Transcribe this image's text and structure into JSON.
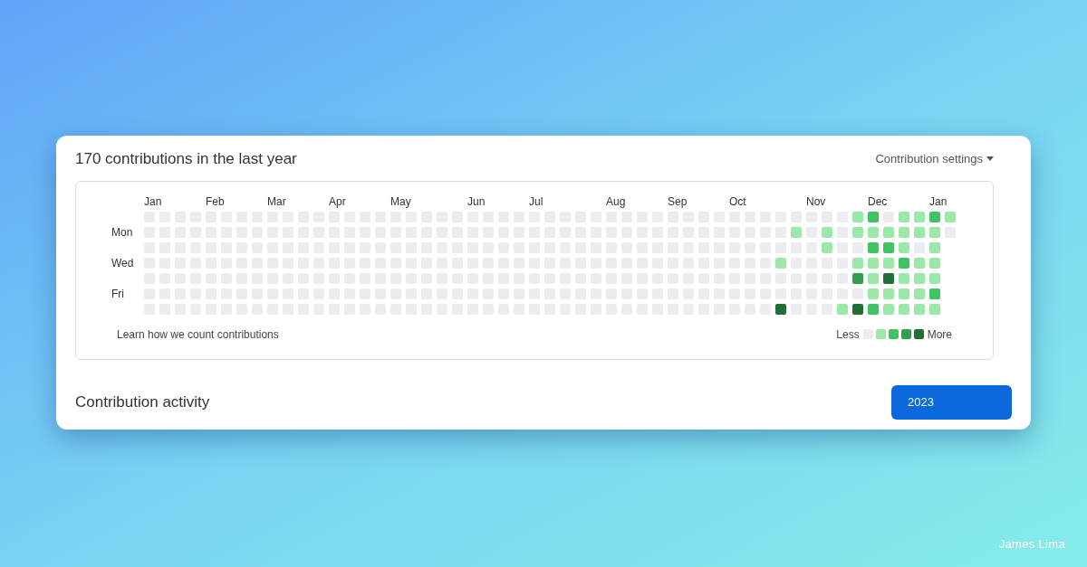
{
  "title": "170 contributions in the last year",
  "settings_menu": {
    "label": "Contribution settings"
  },
  "day_labels": [
    "Mon",
    "Wed",
    "Fri"
  ],
  "weeks": [
    {
      "month": "Jan",
      "days": [
        {
          "color": "#ebedf0"
        },
        {
          "color": "#ebedf0"
        },
        {
          "color": "#ebedf0"
        },
        {
          "color": "#ebedf0"
        },
        {
          "color": "#ebedf0"
        },
        {
          "color": "#ebedf0"
        },
        {
          "color": "#ebedf0"
        }
      ]
    },
    {
      "days": [
        {
          "color": "#ebedf0"
        },
        {
          "color": "#ebedf0"
        },
        {
          "color": "#ebedf0"
        },
        {
          "color": "#ebedf0"
        },
        {
          "color": "#ebedf0"
        },
        {
          "color": "#ebedf0"
        },
        {
          "color": "#ebedf0"
        }
      ]
    },
    {
      "days": [
        {
          "color": "#ebedf0"
        },
        {
          "color": "#ebedf0"
        },
        {
          "color": "#ebedf0"
        },
        {
          "color": "#ebedf0"
        },
        {
          "color": "#ebedf0"
        },
        {
          "color": "#ebedf0"
        },
        {
          "color": "#ebedf0"
        }
      ]
    },
    {
      "days": [
        {
          "color": "#ebedf0"
        },
        {
          "color": "#ebedf0"
        },
        {
          "color": "#ebedf0"
        },
        {
          "color": "#ebedf0"
        },
        {
          "color": "#ebedf0"
        },
        {
          "color": "#ebedf0"
        },
        {
          "color": "#ebedf0"
        }
      ]
    },
    {
      "month": "Feb",
      "days": [
        {
          "color": "#ebedf0"
        },
        {
          "color": "#ebedf0"
        },
        {
          "color": "#ebedf0"
        },
        {
          "color": "#ebedf0"
        },
        {
          "color": "#ebedf0"
        },
        {
          "color": "#ebedf0"
        },
        {
          "color": "#ebedf0"
        }
      ]
    },
    {
      "days": [
        {
          "color": "#ebedf0"
        },
        {
          "color": "#ebedf0"
        },
        {
          "color": "#ebedf0"
        },
        {
          "color": "#ebedf0"
        },
        {
          "color": "#ebedf0"
        },
        {
          "color": "#ebedf0"
        },
        {
          "color": "#ebedf0"
        }
      ]
    },
    {
      "days": [
        {
          "color": "#ebedf0"
        },
        {
          "color": "#ebedf0"
        },
        {
          "color": "#ebedf0"
        },
        {
          "color": "#ebedf0"
        },
        {
          "color": "#ebedf0"
        },
        {
          "color": "#ebedf0"
        },
        {
          "color": "#ebedf0"
        }
      ]
    },
    {
      "days": [
        {
          "color": "#ebedf0"
        },
        {
          "color": "#ebedf0"
        },
        {
          "color": "#ebedf0"
        },
        {
          "color": "#ebedf0"
        },
        {
          "color": "#ebedf0"
        },
        {
          "color": "#ebedf0"
        },
        {
          "color": "#ebedf0"
        }
      ]
    },
    {
      "month": "Mar",
      "days": [
        {
          "color": "#ebedf0"
        },
        {
          "color": "#ebedf0"
        },
        {
          "color": "#ebedf0"
        },
        {
          "color": "#ebedf0"
        },
        {
          "color": "#ebedf0"
        },
        {
          "color": "#ebedf0"
        },
        {
          "color": "#ebedf0"
        }
      ]
    },
    {
      "days": [
        {
          "color": "#ebedf0"
        },
        {
          "color": "#ebedf0"
        },
        {
          "color": "#ebedf0"
        },
        {
          "color": "#ebedf0"
        },
        {
          "color": "#ebedf0"
        },
        {
          "color": "#ebedf0"
        },
        {
          "color": "#ebedf0"
        }
      ]
    },
    {
      "days": [
        {
          "color": "#ebedf0"
        },
        {
          "color": "#ebedf0"
        },
        {
          "color": "#ebedf0"
        },
        {
          "color": "#ebedf0"
        },
        {
          "color": "#ebedf0"
        },
        {
          "color": "#ebedf0"
        },
        {
          "color": "#ebedf0"
        }
      ]
    },
    {
      "days": [
        {
          "color": "#ebedf0"
        },
        {
          "color": "#ebedf0"
        },
        {
          "color": "#ebedf0"
        },
        {
          "color": "#ebedf0"
        },
        {
          "color": "#ebedf0"
        },
        {
          "color": "#ebedf0"
        },
        {
          "color": "#ebedf0"
        }
      ]
    },
    {
      "month": "Apr",
      "days": [
        {
          "color": "#ebedf0"
        },
        {
          "color": "#ebedf0"
        },
        {
          "color": "#ebedf0"
        },
        {
          "color": "#ebedf0"
        },
        {
          "color": "#ebedf0"
        },
        {
          "color": "#ebedf0"
        },
        {
          "color": "#ebedf0"
        }
      ]
    },
    {
      "days": [
        {
          "color": "#ebedf0"
        },
        {
          "color": "#ebedf0"
        },
        {
          "color": "#ebedf0"
        },
        {
          "color": "#ebedf0"
        },
        {
          "color": "#ebedf0"
        },
        {
          "color": "#ebedf0"
        },
        {
          "color": "#ebedf0"
        }
      ]
    },
    {
      "days": [
        {
          "color": "#ebedf0"
        },
        {
          "color": "#ebedf0"
        },
        {
          "color": "#ebedf0"
        },
        {
          "color": "#ebedf0"
        },
        {
          "color": "#ebedf0"
        },
        {
          "color": "#ebedf0"
        },
        {
          "color": "#ebedf0"
        }
      ]
    },
    {
      "days": [
        {
          "color": "#ebedf0"
        },
        {
          "color": "#ebedf0"
        },
        {
          "color": "#ebedf0"
        },
        {
          "color": "#ebedf0"
        },
        {
          "color": "#ebedf0"
        },
        {
          "color": "#ebedf0"
        },
        {
          "color": "#ebedf0"
        }
      ]
    },
    {
      "month": "May",
      "days": [
        {
          "color": "#ebedf0"
        },
        {
          "color": "#ebedf0"
        },
        {
          "color": "#ebedf0"
        },
        {
          "color": "#ebedf0"
        },
        {
          "color": "#ebedf0"
        },
        {
          "color": "#ebedf0"
        },
        {
          "color": "#ebedf0"
        }
      ]
    },
    {
      "days": [
        {
          "color": "#ebedf0"
        },
        {
          "color": "#ebedf0"
        },
        {
          "color": "#ebedf0"
        },
        {
          "color": "#ebedf0"
        },
        {
          "color": "#ebedf0"
        },
        {
          "color": "#ebedf0"
        },
        {
          "color": "#ebedf0"
        }
      ]
    },
    {
      "days": [
        {
          "color": "#ebedf0"
        },
        {
          "color": "#ebedf0"
        },
        {
          "color": "#ebedf0"
        },
        {
          "color": "#ebedf0"
        },
        {
          "color": "#ebedf0"
        },
        {
          "color": "#ebedf0"
        },
        {
          "color": "#ebedf0"
        }
      ]
    },
    {
      "days": [
        {
          "color": "#ebedf0"
        },
        {
          "color": "#ebedf0"
        },
        {
          "color": "#ebedf0"
        },
        {
          "color": "#ebedf0"
        },
        {
          "color": "#ebedf0"
        },
        {
          "color": "#ebedf0"
        },
        {
          "color": "#ebedf0"
        }
      ]
    },
    {
      "days": [
        {
          "color": "#ebedf0"
        },
        {
          "color": "#ebedf0"
        },
        {
          "color": "#ebedf0"
        },
        {
          "color": "#ebedf0"
        },
        {
          "color": "#ebedf0"
        },
        {
          "color": "#ebedf0"
        },
        {
          "color": "#ebedf0"
        }
      ]
    },
    {
      "month": "Jun",
      "days": [
        {
          "color": "#ebedf0"
        },
        {
          "color": "#ebedf0"
        },
        {
          "color": "#ebedf0"
        },
        {
          "color": "#ebedf0"
        },
        {
          "color": "#ebedf0"
        },
        {
          "color": "#ebedf0"
        },
        {
          "color": "#ebedf0"
        }
      ]
    },
    {
      "days": [
        {
          "color": "#ebedf0"
        },
        {
          "color": "#ebedf0"
        },
        {
          "color": "#ebedf0"
        },
        {
          "color": "#ebedf0"
        },
        {
          "color": "#ebedf0"
        },
        {
          "color": "#ebedf0"
        },
        {
          "color": "#ebedf0"
        }
      ]
    },
    {
      "days": [
        {
          "color": "#ebedf0"
        },
        {
          "color": "#ebedf0"
        },
        {
          "color": "#ebedf0"
        },
        {
          "color": "#ebedf0"
        },
        {
          "color": "#ebedf0"
        },
        {
          "color": "#ebedf0"
        },
        {
          "color": "#ebedf0"
        }
      ]
    },
    {
      "days": [
        {
          "color": "#ebedf0"
        },
        {
          "color": "#ebedf0"
        },
        {
          "color": "#ebedf0"
        },
        {
          "color": "#ebedf0"
        },
        {
          "color": "#ebedf0"
        },
        {
          "color": "#ebedf0"
        },
        {
          "color": "#ebedf0"
        }
      ]
    },
    {
      "month": "Jul",
      "days": [
        {
          "color": "#ebedf0"
        },
        {
          "color": "#ebedf0"
        },
        {
          "color": "#ebedf0"
        },
        {
          "color": "#ebedf0"
        },
        {
          "color": "#ebedf0"
        },
        {
          "color": "#ebedf0"
        },
        {
          "color": "#ebedf0"
        }
      ]
    },
    {
      "days": [
        {
          "color": "#ebedf0"
        },
        {
          "color": "#ebedf0"
        },
        {
          "color": "#ebedf0"
        },
        {
          "color": "#ebedf0"
        },
        {
          "color": "#ebedf0"
        },
        {
          "color": "#ebedf0"
        },
        {
          "color": "#ebedf0"
        }
      ]
    },
    {
      "days": [
        {
          "color": "#ebedf0"
        },
        {
          "color": "#ebedf0"
        },
        {
          "color": "#ebedf0"
        },
        {
          "color": "#ebedf0"
        },
        {
          "color": "#ebedf0"
        },
        {
          "color": "#ebedf0"
        },
        {
          "color": "#ebedf0"
        }
      ]
    },
    {
      "days": [
        {
          "color": "#ebedf0"
        },
        {
          "color": "#ebedf0"
        },
        {
          "color": "#ebedf0"
        },
        {
          "color": "#ebedf0"
        },
        {
          "color": "#ebedf0"
        },
        {
          "color": "#ebedf0"
        },
        {
          "color": "#ebedf0"
        }
      ]
    },
    {
      "days": [
        {
          "color": "#ebedf0"
        },
        {
          "color": "#ebedf0"
        },
        {
          "color": "#ebedf0"
        },
        {
          "color": "#ebedf0"
        },
        {
          "color": "#ebedf0"
        },
        {
          "color": "#ebedf0"
        },
        {
          "color": "#ebedf0"
        }
      ]
    },
    {
      "month": "Aug",
      "days": [
        {
          "color": "#ebedf0"
        },
        {
          "color": "#ebedf0"
        },
        {
          "color": "#ebedf0"
        },
        {
          "color": "#ebedf0"
        },
        {
          "color": "#ebedf0"
        },
        {
          "color": "#ebedf0"
        },
        {
          "color": "#ebedf0"
        }
      ]
    },
    {
      "days": [
        {
          "color": "#ebedf0"
        },
        {
          "color": "#ebedf0"
        },
        {
          "color": "#ebedf0"
        },
        {
          "color": "#ebedf0"
        },
        {
          "color": "#ebedf0"
        },
        {
          "color": "#ebedf0"
        },
        {
          "color": "#ebedf0"
        }
      ]
    },
    {
      "days": [
        {
          "color": "#ebedf0"
        },
        {
          "color": "#ebedf0"
        },
        {
          "color": "#ebedf0"
        },
        {
          "color": "#ebedf0"
        },
        {
          "color": "#ebedf0"
        },
        {
          "color": "#ebedf0"
        },
        {
          "color": "#ebedf0"
        }
      ]
    },
    {
      "days": [
        {
          "color": "#ebedf0"
        },
        {
          "color": "#ebedf0"
        },
        {
          "color": "#ebedf0"
        },
        {
          "color": "#ebedf0"
        },
        {
          "color": "#ebedf0"
        },
        {
          "color": "#ebedf0"
        },
        {
          "color": "#ebedf0"
        }
      ]
    },
    {
      "month": "Sep",
      "days": [
        {
          "color": "#ebedf0"
        },
        {
          "color": "#ebedf0"
        },
        {
          "color": "#ebedf0"
        },
        {
          "color": "#ebedf0"
        },
        {
          "color": "#ebedf0"
        },
        {
          "color": "#ebedf0"
        },
        {
          "color": "#ebedf0"
        }
      ]
    },
    {
      "days": [
        {
          "color": "#ebedf0"
        },
        {
          "color": "#ebedf0"
        },
        {
          "color": "#ebedf0"
        },
        {
          "color": "#ebedf0"
        },
        {
          "color": "#ebedf0"
        },
        {
          "color": "#ebedf0"
        },
        {
          "color": "#ebedf0"
        }
      ]
    },
    {
      "days": [
        {
          "color": "#ebedf0"
        },
        {
          "color": "#ebedf0"
        },
        {
          "color": "#ebedf0"
        },
        {
          "color": "#ebedf0"
        },
        {
          "color": "#ebedf0"
        },
        {
          "color": "#ebedf0"
        },
        {
          "color": "#ebedf0"
        }
      ]
    },
    {
      "days": [
        {
          "color": "#ebedf0"
        },
        {
          "color": "#ebedf0"
        },
        {
          "color": "#ebedf0"
        },
        {
          "color": "#ebedf0"
        },
        {
          "color": "#ebedf0"
        },
        {
          "color": "#ebedf0"
        },
        {
          "color": "#ebedf0"
        }
      ]
    },
    {
      "month": "Oct",
      "days": [
        {
          "color": "#ebedf0"
        },
        {
          "color": "#ebedf0"
        },
        {
          "color": "#ebedf0"
        },
        {
          "color": "#ebedf0"
        },
        {
          "color": "#ebedf0"
        },
        {
          "color": "#ebedf0"
        },
        {
          "color": "#ebedf0"
        }
      ]
    },
    {
      "days": [
        {
          "color": "#ebedf0"
        },
        {
          "color": "#ebedf0"
        },
        {
          "color": "#ebedf0"
        },
        {
          "color": "#ebedf0"
        },
        {
          "color": "#ebedf0"
        },
        {
          "color": "#ebedf0"
        },
        {
          "color": "#ebedf0"
        }
      ]
    },
    {
      "days": [
        {
          "color": "#ebedf0"
        },
        {
          "color": "#ebedf0"
        },
        {
          "color": "#ebedf0"
        },
        {
          "color": "#ebedf0"
        },
        {
          "color": "#ebedf0"
        },
        {
          "color": "#ebedf0"
        },
        {
          "color": "#ebedf0"
        }
      ]
    },
    {
      "days": [
        {
          "color": "#ebedf0"
        },
        {
          "color": "#ebedf0"
        },
        {
          "color": "#ebedf0"
        },
        {
          "color": "#9be9a8"
        },
        {
          "color": "#ebedf0"
        },
        {
          "color": "#ebedf0"
        },
        {
          "color": "#216e39"
        }
      ]
    },
    {
      "days": [
        {
          "color": "#ebedf0"
        },
        {
          "color": "#9be9a8"
        },
        {
          "color": "#ebedf0"
        },
        {
          "color": "#ebedf0"
        },
        {
          "color": "#ebedf0"
        },
        {
          "color": "#ebedf0"
        },
        {
          "color": "#ebedf0"
        }
      ]
    },
    {
      "month": "Nov",
      "days": [
        {
          "color": "#ebedf0"
        },
        {
          "color": "#ebedf0"
        },
        {
          "color": "#ebedf0"
        },
        {
          "color": "#ebedf0"
        },
        {
          "color": "#ebedf0"
        },
        {
          "color": "#ebedf0"
        },
        {
          "color": "#ebedf0"
        }
      ]
    },
    {
      "days": [
        {
          "color": "#ebedf0"
        },
        {
          "color": "#9be9a8"
        },
        {
          "color": "#9be9a8"
        },
        {
          "color": "#ebedf0"
        },
        {
          "color": "#ebedf0"
        },
        {
          "color": "#ebedf0"
        },
        {
          "color": "#ebedf0"
        }
      ]
    },
    {
      "days": [
        {
          "color": "#ebedf0"
        },
        {
          "color": "#ebedf0"
        },
        {
          "color": "#ebedf0"
        },
        {
          "color": "#ebedf0"
        },
        {
          "color": "#ebedf0"
        },
        {
          "color": "#ebedf0"
        },
        {
          "color": "#9be9a8"
        }
      ]
    },
    {
      "days": [
        {
          "color": "#9be9a8"
        },
        {
          "color": "#9be9a8"
        },
        {
          "color": "#ebedf0"
        },
        {
          "color": "#9be9a8"
        },
        {
          "color": "#30a14e"
        },
        {
          "color": "#ebedf0"
        },
        {
          "color": "#216e39"
        }
      ]
    },
    {
      "month": "Dec",
      "days": [
        {
          "color": "#40c463"
        },
        {
          "color": "#9be9a8"
        },
        {
          "color": "#40c463"
        },
        {
          "color": "#9be9a8"
        },
        {
          "color": "#9be9a8"
        },
        {
          "color": "#9be9a8"
        },
        {
          "color": "#40c463"
        }
      ]
    },
    {
      "days": [
        {
          "color": "#ebedf0"
        },
        {
          "color": "#9be9a8"
        },
        {
          "color": "#40c463"
        },
        {
          "color": "#9be9a8"
        },
        {
          "color": "#216e39"
        },
        {
          "color": "#9be9a8"
        },
        {
          "color": "#9be9a8"
        }
      ]
    },
    {
      "days": [
        {
          "color": "#9be9a8"
        },
        {
          "color": "#9be9a8"
        },
        {
          "color": "#9be9a8"
        },
        {
          "color": "#40c463"
        },
        {
          "color": "#9be9a8"
        },
        {
          "color": "#9be9a8"
        },
        {
          "color": "#9be9a8"
        }
      ]
    },
    {
      "days": [
        {
          "color": "#9be9a8"
        },
        {
          "color": "#9be9a8"
        },
        {
          "color": "#ebedf0"
        },
        {
          "color": "#9be9a8"
        },
        {
          "color": "#9be9a8"
        },
        {
          "color": "#9be9a8"
        },
        {
          "color": "#9be9a8"
        }
      ]
    },
    {
      "month": "Jan",
      "days": [
        {
          "color": "#40c463"
        },
        {
          "color": "#9be9a8"
        },
        {
          "color": "#9be9a8"
        },
        {
          "color": "#9be9a8"
        },
        {
          "color": "#9be9a8"
        },
        {
          "color": "#40c463"
        },
        {
          "color": "#9be9a8"
        }
      ]
    },
    {
      "days": [
        {
          "color": "#9be9a8"
        },
        {
          "color": "#ebedf0"
        }
      ]
    }
  ],
  "learn_link": "Learn how we count contributions",
  "legend": {
    "less": "Less",
    "more": "More",
    "swatches": [
      {
        "color": "#ebedf0"
      },
      {
        "color": "#9be9a8"
      },
      {
        "color": "#40c463"
      },
      {
        "color": "#30a14e"
      },
      {
        "color": "#216e39"
      }
    ]
  },
  "activity_heading": "Contribution activity",
  "years": [
    {
      "label": "2023",
      "selected": true
    }
  ],
  "credit": "James Lima"
}
